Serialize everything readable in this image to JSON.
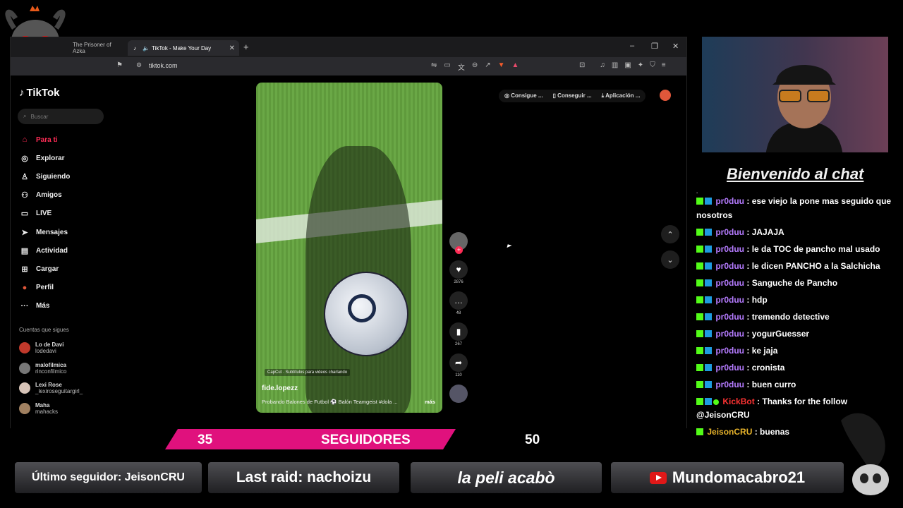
{
  "browser": {
    "tabs": [
      {
        "title": "The Prisoner of Azka",
        "active": false
      },
      {
        "title": "TikTok - Make Your Day",
        "active": true
      }
    ],
    "url": "tiktok.com"
  },
  "tiktok": {
    "logo": "TikTok",
    "search_placeholder": "Buscar",
    "nav": [
      {
        "label": "Para ti",
        "icon": "home-icon",
        "active": true
      },
      {
        "label": "Explorar",
        "icon": "compass-icon"
      },
      {
        "label": "Siguiendo",
        "icon": "following-icon"
      },
      {
        "label": "Amigos",
        "icon": "friends-icon"
      },
      {
        "label": "LIVE",
        "icon": "live-icon"
      },
      {
        "label": "Mensajes",
        "icon": "messages-icon"
      },
      {
        "label": "Actividad",
        "icon": "activity-icon"
      },
      {
        "label": "Cargar",
        "icon": "upload-icon"
      },
      {
        "label": "Perfil",
        "icon": "profile-icon"
      },
      {
        "label": "Más",
        "icon": "more-icon"
      }
    ],
    "following_title": "Cuentas que sigues",
    "following": [
      {
        "name": "Lo de Davi",
        "user": "lodedavi"
      },
      {
        "name": "malofilmica",
        "user": "rinconfilmico"
      },
      {
        "name": "Lexi Rose",
        "user": "_lexiroseguitargirl_"
      },
      {
        "name": "Maha",
        "user": "mahacks"
      }
    ],
    "top_buttons": [
      "Consigue ...",
      "Conseguir ...",
      "Aplicación ..."
    ],
    "video": {
      "overlay": "CapCut · Subtítulos para videos charlando",
      "username": "fide.lopezz",
      "description": "Probando Balones de Futbol ⚽ Balón Teamgeist #dola ...",
      "more": "más",
      "likes": "2876",
      "comments": "48",
      "saves": "267",
      "shares": "110"
    }
  },
  "chat": {
    "title": "Bienvenido al chat",
    "messages": [
      {
        "user": "pr0duu",
        "text": ": ese viejo la pone mas seguido que nosotros"
      },
      {
        "user": "pr0duu",
        "text": ": JAJAJA"
      },
      {
        "user": "pr0duu",
        "text": ": le da TOC de pancho mal usado"
      },
      {
        "user": "pr0duu",
        "text": ": le dicen PANCHO a la Salchicha"
      },
      {
        "user": "pr0duu",
        "text": ": Sanguche de Pancho"
      },
      {
        "user": "pr0duu",
        "text": ": hdp"
      },
      {
        "user": "pr0duu",
        "text": ": tremendo detective"
      },
      {
        "user": "pr0duu",
        "text": ": yogurGuesser"
      },
      {
        "user": "pr0duu",
        "text": ": ke jaja"
      },
      {
        "user": "pr0duu",
        "text": ": cronista"
      },
      {
        "user": "pr0duu",
        "text": ": buen curro"
      },
      {
        "user": "KickBot",
        "text": ": Thanks for the follow @JeisonCRU"
      },
      {
        "user": "JeisonCRU",
        "text": ": buenas"
      }
    ]
  },
  "overlay": {
    "goal_current": "35",
    "goal_label": "SEGUIDORES",
    "goal_target": "50",
    "last_follower": "Último seguidor: JeisonCRU",
    "last_raid": "Last raid: nachoizu",
    "status": "la peli acabò",
    "youtube": "Mundomacabro21"
  },
  "colors": {
    "accent_pink": "#e0117d",
    "tiktok_red": "#fe2c55",
    "chat_user": "#b57bff"
  }
}
